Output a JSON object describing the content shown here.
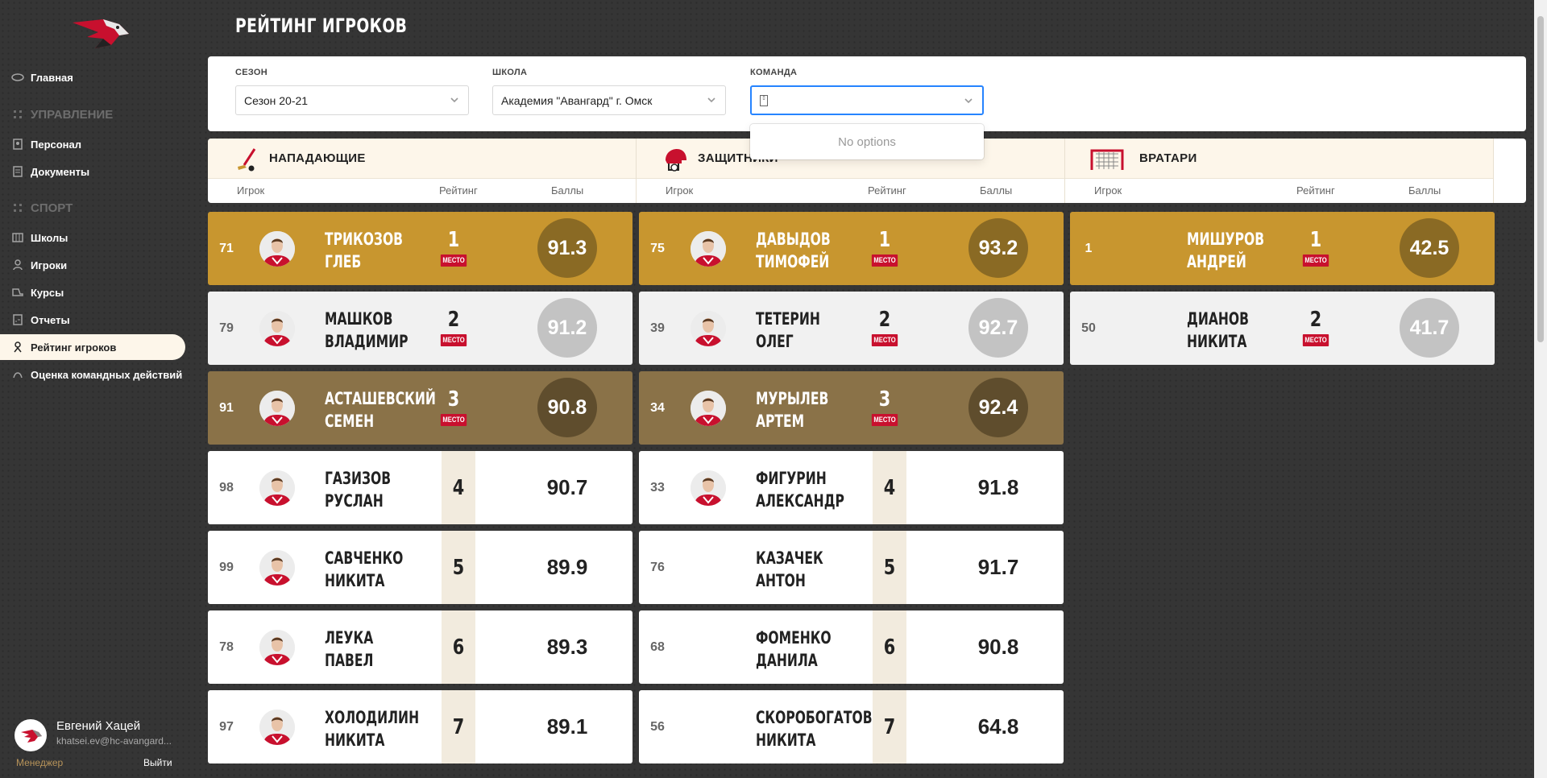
{
  "page_title": "РЕЙТИНГ ИГРОКОВ",
  "sidebar": {
    "items": [
      {
        "label": "Главная",
        "icon": "puck-icon"
      },
      {
        "label": "УПРАВЛЕНИЕ",
        "section": true
      },
      {
        "label": "Персонал",
        "icon": "staff-icon"
      },
      {
        "label": "Документы",
        "icon": "document-icon"
      },
      {
        "label": "СПОРТ",
        "section": true
      },
      {
        "label": "Школы",
        "icon": "school-icon"
      },
      {
        "label": "Игроки",
        "icon": "player-icon"
      },
      {
        "label": "Курсы",
        "icon": "skate-icon"
      },
      {
        "label": "Отчеты",
        "icon": "report-icon"
      },
      {
        "label": "Рейтинг игроков",
        "icon": "rating-icon",
        "active": true
      },
      {
        "label": "Оценка командных действий",
        "icon": "team-eval-icon"
      }
    ]
  },
  "user": {
    "name": "Евгений Хацей",
    "email": "khatsei.ev@hc-avangard...",
    "role": "Менеджер",
    "logout": "Выйти"
  },
  "filters": {
    "season": {
      "label": "СЕЗОН",
      "value": "Сезон 20-21"
    },
    "school": {
      "label": "ШКОЛА",
      "value": "Академия \"Авангард\" г. Омск"
    },
    "team": {
      "label": "КОМАНДА",
      "value": ""
    },
    "dropdown_message": "No options"
  },
  "columns": {
    "headers": {
      "player": "Игрок",
      "rating": "Рейтинг",
      "points": "Баллы",
      "place_badge": "МЕСТО"
    },
    "forwards": {
      "title": "НАПАДАЮЩИЕ",
      "players": [
        {
          "num": "71",
          "name1": "ТРИКОЗОВ",
          "name2": "ГЛЕБ",
          "place": "1",
          "points": "91.3"
        },
        {
          "num": "79",
          "name1": "МАШКОВ",
          "name2": "ВЛАДИМИР",
          "place": "2",
          "points": "91.2"
        },
        {
          "num": "91",
          "name1": "АСТАШЕВСКИЙ",
          "name2": "СЕМЕН",
          "place": "3",
          "points": "90.8"
        },
        {
          "num": "98",
          "name1": "ГАЗИЗОВ",
          "name2": "РУСЛАН",
          "place": "4",
          "points": "90.7"
        },
        {
          "num": "99",
          "name1": "САВЧЕНКО",
          "name2": "НИКИТА",
          "place": "5",
          "points": "89.9"
        },
        {
          "num": "78",
          "name1": "ЛЕУКА",
          "name2": "ПАВЕЛ",
          "place": "6",
          "points": "89.3"
        },
        {
          "num": "97",
          "name1": "ХОЛОДИЛИН",
          "name2": "НИКИТА",
          "place": "7",
          "points": "89.1"
        }
      ]
    },
    "defenders": {
      "title": "ЗАЩИТНИКИ",
      "players": [
        {
          "num": "75",
          "name1": "ДАВЫДОВ",
          "name2": "ТИМОФЕЙ",
          "place": "1",
          "points": "93.2"
        },
        {
          "num": "39",
          "name1": "ТЕТЕРИН",
          "name2": "ОЛЕГ",
          "place": "2",
          "points": "92.7"
        },
        {
          "num": "34",
          "name1": "МУРЫЛЕВ",
          "name2": "АРТЕМ",
          "place": "3",
          "points": "92.4"
        },
        {
          "num": "33",
          "name1": "ФИГУРИН",
          "name2": "АЛЕКСАНДР",
          "place": "4",
          "points": "91.8"
        },
        {
          "num": "76",
          "name1": "КАЗАЧЕК",
          "name2": "АНТОН",
          "place": "5",
          "points": "91.7"
        },
        {
          "num": "68",
          "name1": "ФОМЕНКО",
          "name2": "ДАНИЛА",
          "place": "6",
          "points": "90.8"
        },
        {
          "num": "56",
          "name1": "СКОРОБОГАТОВ",
          "name2": "НИКИТА",
          "place": "7",
          "points": "64.8"
        }
      ]
    },
    "goalies": {
      "title": "ВРАТАРИ",
      "players": [
        {
          "num": "1",
          "name1": "МИШУРОВ",
          "name2": "АНДРЕЙ",
          "place": "1",
          "points": "42.5"
        },
        {
          "num": "50",
          "name1": "ДИАНОВ",
          "name2": "НИКИТА",
          "place": "2",
          "points": "41.7"
        }
      ]
    }
  },
  "colors": {
    "gold": "#c8962f",
    "silver": "#f1f1f1",
    "bronze": "#8a7248",
    "badge": "#c8102e",
    "accent": "#2684ff"
  }
}
